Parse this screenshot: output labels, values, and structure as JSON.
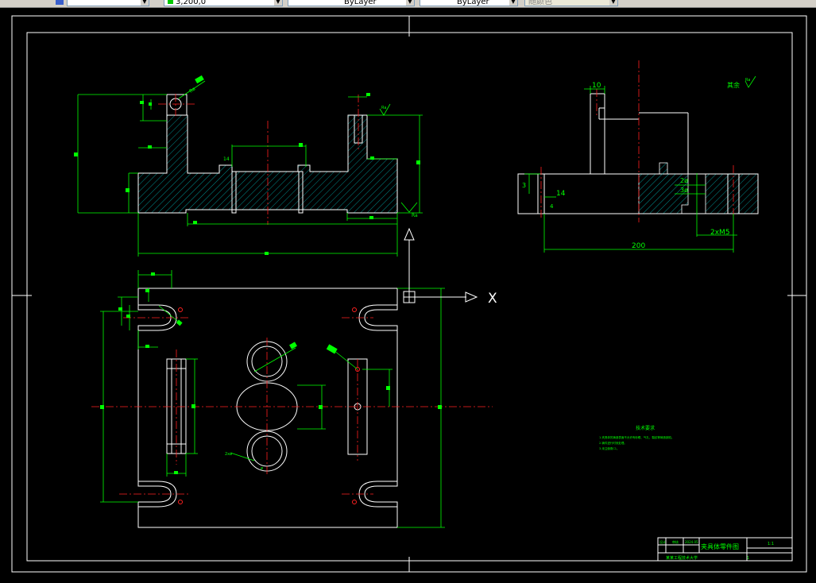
{
  "toolbar": {
    "field1": "",
    "color_value": "3,200,0",
    "linetype_value": "ByLayer",
    "lineweight_value": "ByLayer",
    "plotstyle_value": "随颜色"
  },
  "drawing": {
    "dim_top_width": "10",
    "dim_3": "3",
    "dim_14": "14",
    "dim_4": "4",
    "dim_200": "200",
    "dim_2x_m5": "2xM5",
    "dim_2phi": "2ø",
    "dim_3phi": "3ø",
    "axis_x_label": "X",
    "surface_note": "其余",
    "surface_symbol": "Ra",
    "tech_title": "技术要求",
    "tech_lines": [
      "1.夹具体的铸造表面不允许有砂眼、气孔、裂纹等铸造缺陷。",
      "2.铸件进行时效处理。",
      "3.未注倒角C1。"
    ],
    "title_block": {
      "part_name": "夹具体零件图",
      "scale": "1:1",
      "school": "某某工程技术大学",
      "sheet": "1"
    }
  }
}
